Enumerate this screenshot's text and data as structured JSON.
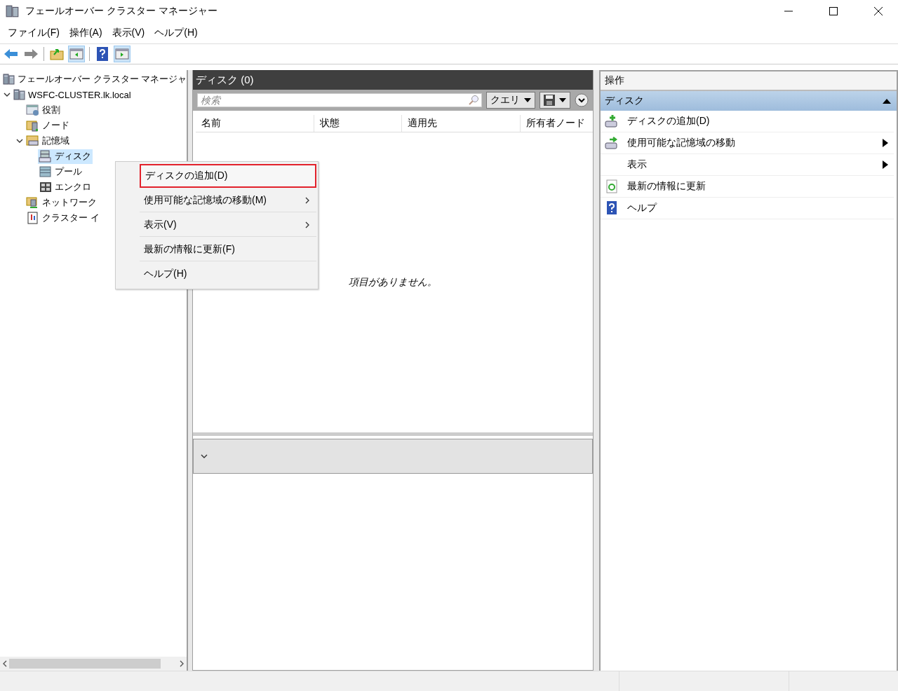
{
  "window": {
    "title": "フェールオーバー クラスター マネージャー"
  },
  "menu_bar": [
    "ファイル(F)",
    "操作(A)",
    "表示(V)",
    "ヘルプ(H)"
  ],
  "tree": [
    {
      "label": "フェールオーバー クラスター マネージャ",
      "selected": false,
      "children": [
        {
          "label": "WSFC-CLUSTER.lk.local",
          "selected": false,
          "expanded": true,
          "children": [
            {
              "label": "役割",
              "selected": false,
              "kind": "roles"
            },
            {
              "label": "ノード",
              "selected": false,
              "kind": "nodes"
            },
            {
              "label": "記憶域",
              "selected": false,
              "expanded": true,
              "kind": "storage",
              "children": [
                {
                  "label": "ディスク",
                  "selected": true,
                  "kind": "disks"
                },
                {
                  "label": "プール",
                  "selected": false,
                  "kind": "pools"
                },
                {
                  "label": "エンクロ",
                  "selected": false,
                  "kind": "enclosures"
                }
              ]
            },
            {
              "label": "ネットワーク",
              "selected": false,
              "kind": "networks"
            },
            {
              "label": "クラスター イ",
              "selected": false,
              "kind": "events"
            }
          ],
          "kind": "cluster"
        }
      ],
      "kind": "manager"
    }
  ],
  "center": {
    "title": "ディスク (0)",
    "search": {
      "placeholder": "検索"
    },
    "query_button": "クエリ",
    "columns": [
      "名前",
      "状態",
      "適用先",
      "所有者ノード"
    ],
    "empty_message": "項目がありません。"
  },
  "actions": {
    "title": "操作",
    "section": {
      "label": "ディスク",
      "expanded": true
    },
    "items": [
      {
        "label": "ディスクの追加(D)",
        "kind": "add",
        "submenu": false
      },
      {
        "label": "使用可能な記憶域の移動",
        "kind": "move",
        "submenu": true
      },
      {
        "label": "表示",
        "kind": "plain",
        "submenu": true
      },
      {
        "label": "最新の情報に更新",
        "kind": "refresh",
        "submenu": false
      },
      {
        "label": "ヘルプ",
        "kind": "help",
        "submenu": false
      }
    ]
  },
  "context_menu": {
    "items": [
      {
        "label": "ディスクの追加(D)",
        "submenu": false,
        "selected": true
      },
      {
        "label": "使用可能な記憶域の移動(M)",
        "submenu": true,
        "selected": false
      },
      {
        "label": "表示(V)",
        "submenu": true,
        "selected": false
      },
      {
        "label": "最新の情報に更新(F)",
        "submenu": false,
        "selected": false
      },
      {
        "label": "ヘルプ(H)",
        "submenu": false,
        "selected": false
      }
    ]
  }
}
